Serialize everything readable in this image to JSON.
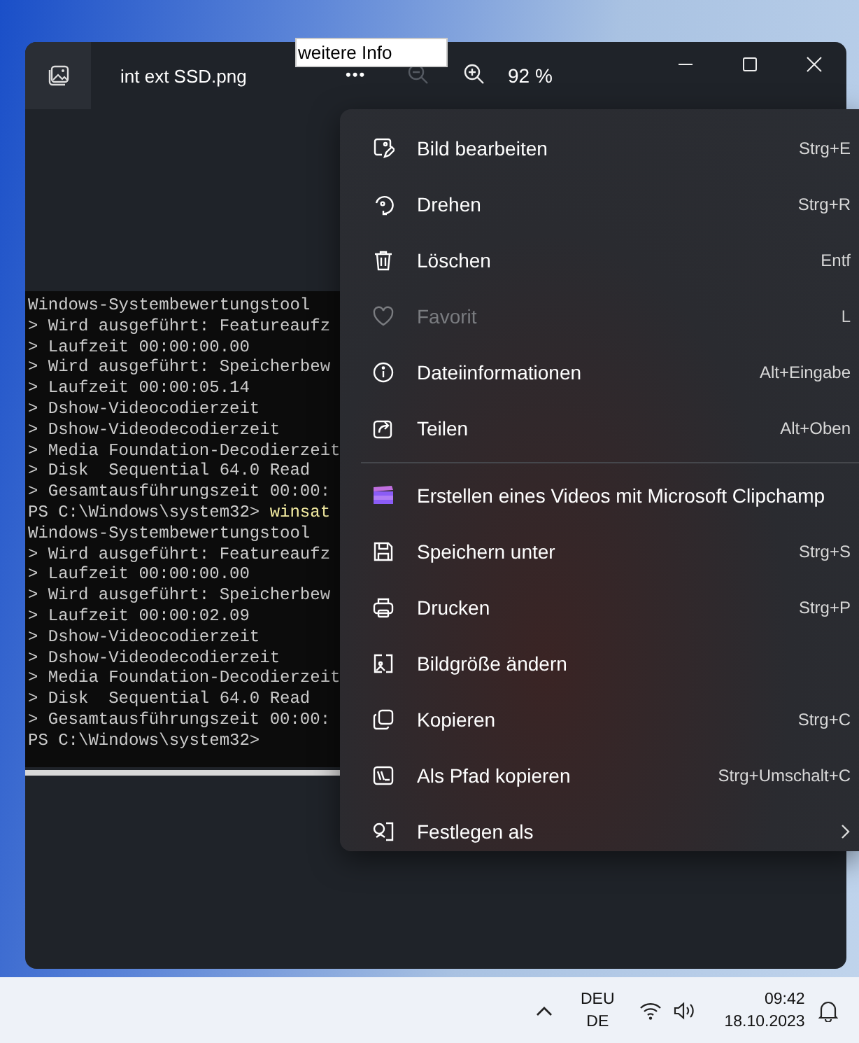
{
  "tooltip": {
    "text": "weitere Info"
  },
  "window": {
    "title": "int ext SSD.png",
    "more": "•••",
    "zoom": "92 %",
    "zoom_out_disabled": true
  },
  "terminal": {
    "lines": [
      {
        "kind": "output",
        "text": "Windows-Systembewertungstool"
      },
      {
        "kind": "output",
        "text": "> Wird ausgeführt: Featureaufz"
      },
      {
        "kind": "output",
        "text": "> Laufzeit 00:00:00.00"
      },
      {
        "kind": "output",
        "text": "> Wird ausgeführt: Speicherbew"
      },
      {
        "kind": "output",
        "text": "> Laufzeit 00:00:05.14"
      },
      {
        "kind": "output",
        "text": "> Dshow-Videocodierzeit"
      },
      {
        "kind": "output",
        "text": "> Dshow-Videodecodierzeit"
      },
      {
        "kind": "output",
        "text": "> Media Foundation-Decodierzeit"
      },
      {
        "kind": "output",
        "text": "> Disk  Sequential 64.0 Read"
      },
      {
        "kind": "output",
        "text": "> Gesamtausführungszeit 00:00:"
      },
      {
        "kind": "prompt",
        "text": "PS C:\\Windows\\system32>",
        "command": "winsat"
      },
      {
        "kind": "output",
        "text": "Windows-Systembewertungstool"
      },
      {
        "kind": "output",
        "text": "> Wird ausgeführt: Featureaufz"
      },
      {
        "kind": "output",
        "text": "> Laufzeit 00:00:00.00"
      },
      {
        "kind": "output",
        "text": "> Wird ausgeführt: Speicherbew"
      },
      {
        "kind": "output",
        "text": "> Laufzeit 00:00:02.09"
      },
      {
        "kind": "output",
        "text": "> Dshow-Videocodierzeit"
      },
      {
        "kind": "output",
        "text": "> Dshow-Videodecodierzeit"
      },
      {
        "kind": "output",
        "text": "> Media Foundation-Decodierzeit"
      },
      {
        "kind": "output",
        "text": "> Disk  Sequential 64.0 Read"
      },
      {
        "kind": "output",
        "text": "> Gesamtausführungszeit 00:00:"
      },
      {
        "kind": "prompt",
        "text": "PS C:\\Windows\\system32>"
      }
    ]
  },
  "menu": {
    "items": [
      {
        "kind": "item",
        "label": "Bild bearbeiten",
        "shortcut": "Strg+E",
        "disabled": false
      },
      {
        "kind": "item",
        "label": "Drehen",
        "shortcut": "Strg+R",
        "disabled": false
      },
      {
        "kind": "item",
        "label": "Löschen",
        "shortcut": "Entf",
        "disabled": false
      },
      {
        "kind": "item",
        "label": "Favorit",
        "shortcut": "L",
        "disabled": true
      },
      {
        "kind": "item",
        "label": "Dateiinformationen",
        "shortcut": "Alt+Eingabe",
        "disabled": false
      },
      {
        "kind": "item",
        "label": "Teilen",
        "shortcut": "Alt+Oben",
        "disabled": false
      },
      {
        "kind": "separator"
      },
      {
        "kind": "item",
        "label": "Erstellen eines Videos mit Microsoft Clipchamp",
        "disabled": false
      },
      {
        "kind": "item",
        "label": "Speichern unter",
        "shortcut": "Strg+S",
        "disabled": false
      },
      {
        "kind": "item",
        "label": "Drucken",
        "shortcut": "Strg+P",
        "disabled": false
      },
      {
        "kind": "item",
        "label": "Bildgröße ändern",
        "disabled": false
      },
      {
        "kind": "item",
        "label": "Kopieren",
        "shortcut": "Strg+C",
        "disabled": false
      },
      {
        "kind": "item",
        "label": "Als Pfad kopieren",
        "shortcut": "Strg+Umschalt+C",
        "disabled": false
      },
      {
        "kind": "item",
        "label": "Festlegen als",
        "disabled": false,
        "submenu": true
      }
    ]
  },
  "taskbar": {
    "language": "DEU",
    "layout": "DE",
    "time": "09:42",
    "date": "18.10.2023"
  }
}
